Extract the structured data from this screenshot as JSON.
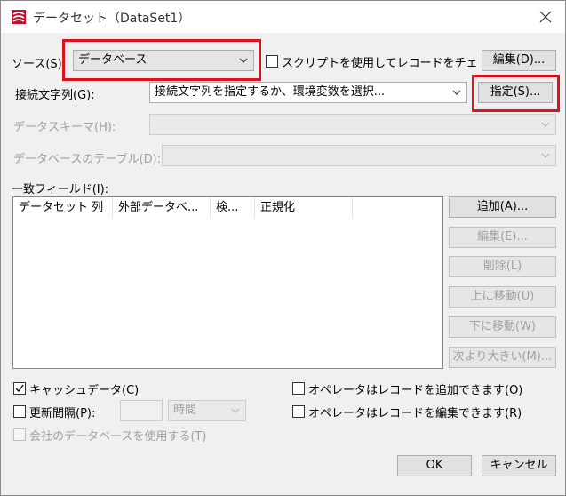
{
  "window": {
    "title": "データセット（DataSet1）"
  },
  "source": {
    "label": "ソース(S):",
    "value": "データベース",
    "script_check_label": "スクリプトを使用してレコードをチェック(",
    "edit_button": "編集(D)..."
  },
  "connection": {
    "label": "接続文字列(G):",
    "value": "接続文字列を指定するか、環境変数を選択...",
    "specify_button": "指定(S)..."
  },
  "schema": {
    "label": "データスキーマ(H):",
    "value": ""
  },
  "table": {
    "label": "データベースのテーブル(D):",
    "value": ""
  },
  "fields": {
    "label": "一致フィールド(I):",
    "columns": [
      "データセット 列",
      "外部データベ...",
      "検...",
      "正規化"
    ],
    "buttons": {
      "add": "追加(A)...",
      "edit": "編集(E)...",
      "delete": "削除(L)",
      "up": "上に移動(U)",
      "down": "下に移動(W)",
      "next_larger": "次より大きい(M)..."
    }
  },
  "options": {
    "cache_data": {
      "label": "キャッシュデータ(C)",
      "checked": true
    },
    "update_interval": {
      "label": "更新間隔(P):",
      "value": "",
      "unit": "時間"
    },
    "use_company_db": {
      "label": "会社のデータベースを使用する(T)"
    },
    "operator_add": {
      "label": "オペレータはレコードを追加できます(O)"
    },
    "operator_edit": {
      "label": "オペレータはレコードを編集できます(R)"
    }
  },
  "footer": {
    "ok": "OK",
    "cancel": "キャンセル"
  },
  "colors": {
    "highlight": "#e0101d",
    "app_icon": "#c8102e"
  },
  "icons": {
    "app": "app-icon",
    "close": "close-icon",
    "dropdown": "chevron-down-icon",
    "check": "checkmark-icon"
  }
}
